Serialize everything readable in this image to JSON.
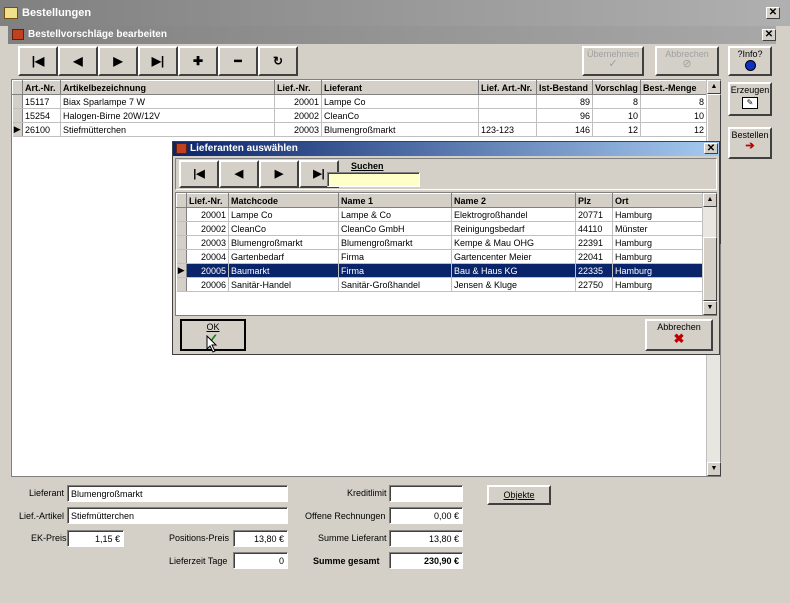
{
  "window": {
    "title": "Bestellungen"
  },
  "subwindow": {
    "title": "Bestellvorschläge bearbeiten"
  },
  "toolbar": {
    "nav": [
      "|◀",
      "◀",
      "▶",
      "▶|",
      "✚",
      "━",
      "↻"
    ],
    "uebernehmen": "Übernehmen",
    "abbrechen": "Abbrechen",
    "info": "?Info?",
    "erzeugen": "Erzeugen",
    "bestellen": "Bestellen"
  },
  "main_table": {
    "columns": [
      "Art.-Nr.",
      "Artikelbezeichnung",
      "Lief.-Nr.",
      "Lieferant",
      "Lief. Art.-Nr.",
      "Ist-Bestand",
      "Vorschlag",
      "Best.-Menge"
    ],
    "rows": [
      [
        "15117",
        "Biax Sparlampe 7 W",
        "20001",
        "Lampe  Co",
        "",
        "89",
        "8",
        "8"
      ],
      [
        "15254",
        "Halogen-Birne 20W/12V",
        "20002",
        "CleanCo",
        "",
        "96",
        "10",
        "10"
      ],
      [
        "26100",
        "Stiefmütterchen",
        "20003",
        "Blumengroßmarkt",
        "123-123",
        "146",
        "12",
        "12"
      ]
    ],
    "current_row": 2
  },
  "dialog": {
    "title": "Lieferanten auswählen",
    "search_label": "Suchen",
    "search_value": "",
    "nav": [
      "|◀",
      "◀",
      "▶",
      "▶|"
    ],
    "columns": [
      "Lief.-Nr.",
      "Matchcode",
      "Name 1",
      "Name 2",
      "Plz",
      "Ort"
    ],
    "rows": [
      [
        "20001",
        "Lampe  Co",
        "Lampe & Co",
        "Elektrogroßhandel",
        "20771",
        "Hamburg"
      ],
      [
        "20002",
        "CleanCo",
        "CleanCo GmbH",
        "Reinigungsbedarf",
        "44110",
        "Münster"
      ],
      [
        "20003",
        "Blumengroßmarkt",
        "Blumengroßmarkt",
        "Kempe & Mau OHG",
        "22391",
        "Hamburg"
      ],
      [
        "20004",
        "Gartenbedarf",
        "Firma",
        "Gartencenter Meier",
        "22041",
        "Hamburg"
      ],
      [
        "20005",
        "Baumarkt",
        "Firma",
        "Bau & Haus KG",
        "22335",
        "Hamburg"
      ],
      [
        "20006",
        "Sanitär-Handel",
        "Sanitär-Großhandel",
        "Jensen & Kluge",
        "22750",
        "Hamburg"
      ]
    ],
    "selected_row": 4,
    "ok": "OK",
    "cancel": "Abbrechen"
  },
  "form": {
    "lieferant_label": "Lieferant",
    "lieferant_value": "Blumengroßmarkt",
    "liefartikel_label": "Lief.-Artikel",
    "liefartikel_value": "Stiefmütterchen",
    "ekpreis_label": "EK-Preis",
    "ekpreis_value": "1,15 €",
    "positionspreis_label": "Positions-Preis",
    "positionspreis_value": "13,80 €",
    "lieferzeit_label": "Lieferzeit Tage",
    "lieferzeit_value": "0",
    "kreditlimit_label": "Kreditlimit",
    "kreditlimit_value": "",
    "offene_label": "Offene Rechnungen",
    "offene_value": "0,00 €",
    "summe_lieferant_label": "Summe Lieferant",
    "summe_lieferant_value": "13,80 €",
    "summe_gesamt_label": "Summe gesamt",
    "summe_gesamt_value": "230,90 €",
    "objekte": "Objekte"
  },
  "colors": {
    "selection": "#0a246a",
    "dialog_title": "#0a246a",
    "cancel_x": "#c00000",
    "ok_check": "#108010"
  }
}
